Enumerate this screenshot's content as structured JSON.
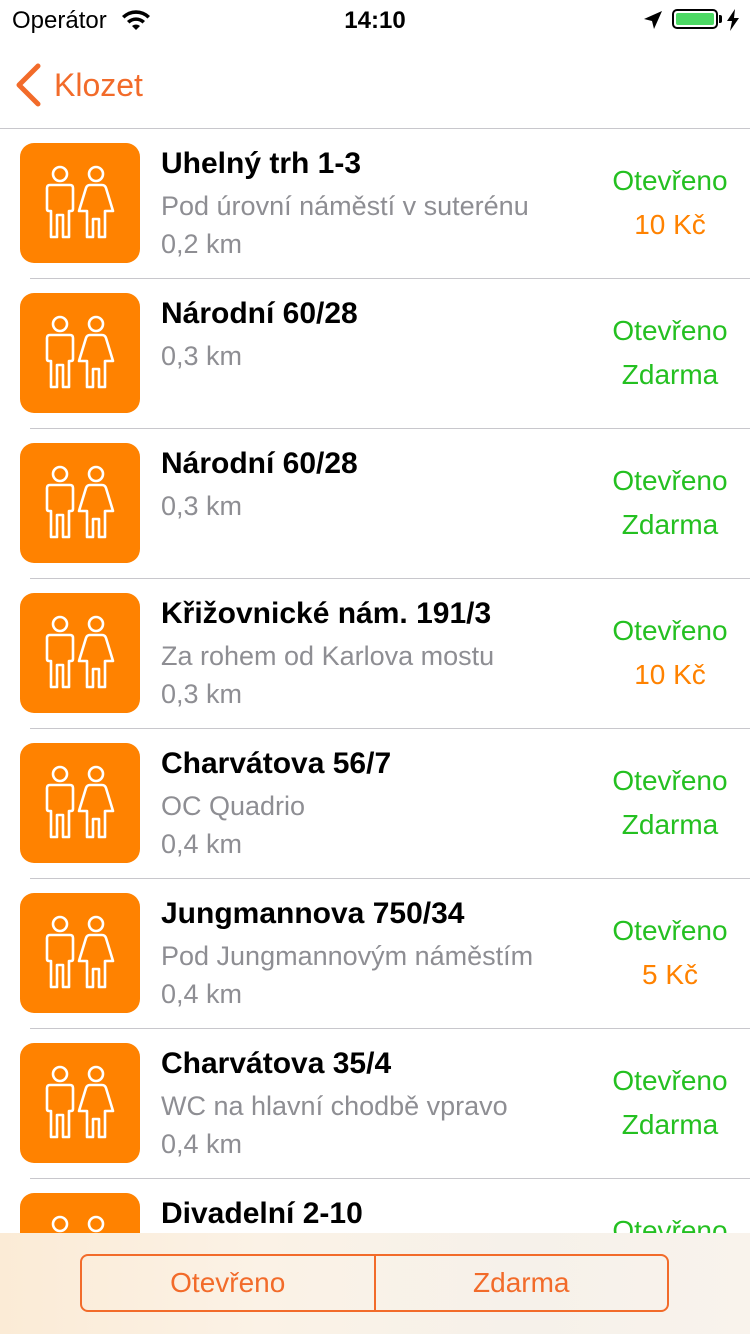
{
  "status_bar": {
    "carrier": "Operátor",
    "time": "14:10",
    "battery_level": 1.0,
    "battery_color": "#4cd964"
  },
  "nav": {
    "back_label": "Klozet",
    "back_icon": "chevron-left-icon",
    "accent_color": "#f26b2a"
  },
  "colors": {
    "icon_background": "#ff8200",
    "open_green": "#24c021",
    "paid_orange": "#ff8200",
    "secondary_gray": "#8e8e93"
  },
  "toilets": [
    {
      "title": "Uhelný trh 1-3",
      "subtitle": "Pod úrovní náměstí v suterénu",
      "distance": "0,2 km",
      "status": "Otevřeno",
      "price": "10 Kč",
      "paid": true
    },
    {
      "title": "Národní 60/28",
      "subtitle": "",
      "distance": "0,3 km",
      "status": "Otevřeno",
      "price": "Zdarma",
      "paid": false
    },
    {
      "title": "Národní 60/28",
      "subtitle": "",
      "distance": "0,3 km",
      "status": "Otevřeno",
      "price": "Zdarma",
      "paid": false
    },
    {
      "title": "Křižovnické nám. 191/3",
      "subtitle": "Za rohem od Karlova mostu",
      "distance": "0,3 km",
      "status": "Otevřeno",
      "price": "10 Kč",
      "paid": true
    },
    {
      "title": "Charvátova 56/7",
      "subtitle": "OC Quadrio",
      "distance": "0,4 km",
      "status": "Otevřeno",
      "price": "Zdarma",
      "paid": false
    },
    {
      "title": "Jungmannova 750/34",
      "subtitle": "Pod Jungmannovým náměstím",
      "distance": "0,4 km",
      "status": "Otevřeno",
      "price": "5 Kč",
      "paid": true
    },
    {
      "title": "Charvátova 35/4",
      "subtitle": "WC na hlavní chodbě vpravo",
      "distance": "0,4 km",
      "status": "Otevřeno",
      "price": "Zdarma",
      "paid": false
    },
    {
      "title": "Divadelní 2-10",
      "subtitle": "",
      "distance": "",
      "status": "Otevřeno",
      "price": "",
      "paid": false
    }
  ],
  "filters": {
    "open_label": "Otevřeno",
    "free_label": "Zdarma"
  }
}
